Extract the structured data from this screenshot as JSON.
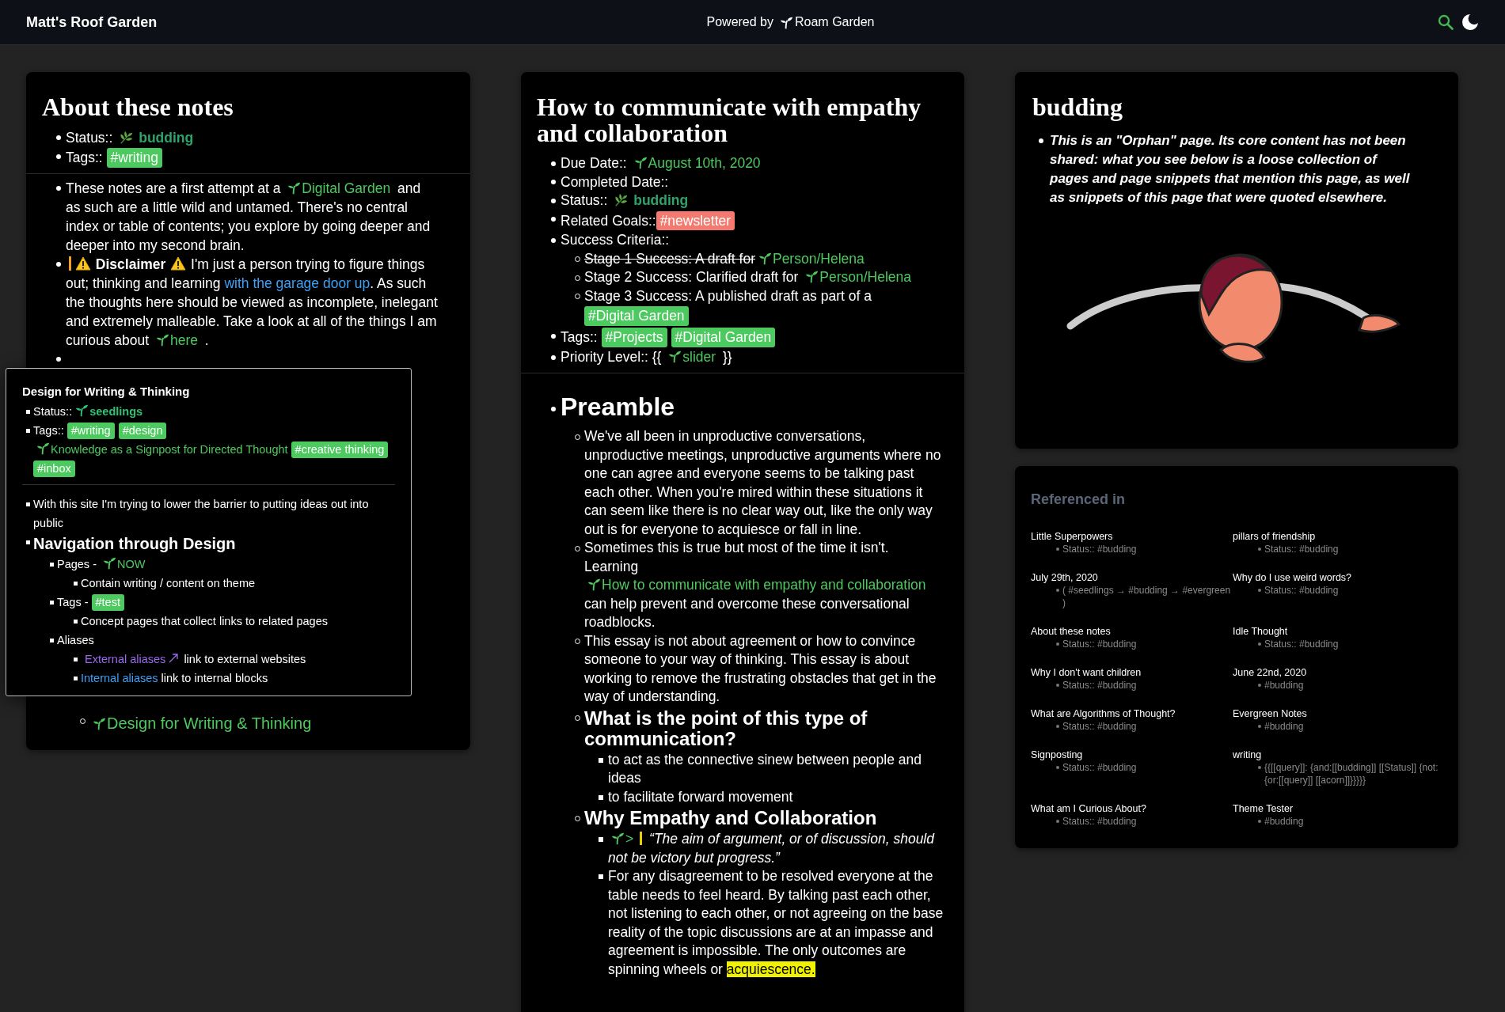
{
  "header": {
    "site_title": "Matt's Roof Garden",
    "powered_by": "Powered by",
    "product": "Roam Garden"
  },
  "left_note": {
    "title": "About these notes",
    "meta": [
      {
        "kind": "text",
        "segments": [
          {
            "kind": "text",
            "text": "Status:: "
          },
          {
            "kind": "status",
            "text": "budding"
          }
        ]
      },
      {
        "kind": "text",
        "segments": [
          {
            "kind": "text",
            "text": "Tags:: "
          },
          {
            "kind": "tag",
            "text": "#writing",
            "color": "#4cc95f"
          }
        ]
      }
    ],
    "body": [
      {
        "kind": "text",
        "segments": [
          {
            "kind": "text",
            "text": "These notes are a first attempt at a "
          },
          {
            "kind": "page",
            "text": "Digital Garden"
          },
          {
            "kind": "text",
            "text": " and as such are a little wild and untamed. There's no central index or table of contents; you explore by going deeper and deeper into my second brain."
          }
        ]
      },
      {
        "kind": "text",
        "segments": [
          {
            "kind": "bar",
            "color": "#f0a020"
          },
          {
            "kind": "warning"
          },
          {
            "kind": "bold",
            "text": " Disclaimer "
          },
          {
            "kind": "warning"
          },
          {
            "kind": "text",
            "text": " I'm just a person trying to figure things out; thinking and learning "
          },
          {
            "kind": "url",
            "text": "with the garage door up"
          },
          {
            "kind": "text",
            "text": ". As such the thoughts here should be viewed as incomplete, inelegant and extremely malleable.  Take a look at all of the things I am curious about "
          },
          {
            "kind": "page",
            "text": "here"
          },
          {
            "kind": "text",
            "text": " ."
          }
        ]
      },
      {
        "kind": "text"
      }
    ],
    "footer": [
      {
        "kind": "text",
        "segments": [
          {
            "kind": "page",
            "text": "Design for Writing & Thinking"
          }
        ]
      }
    ]
  },
  "popup": {
    "title": "Design for Writing & Thinking",
    "meta": [
      {
        "kind": "text",
        "segments": [
          {
            "kind": "text",
            "text": "Status:: "
          },
          {
            "kind": "page-bold",
            "text": "seedlings"
          }
        ]
      },
      {
        "kind": "text",
        "segments": [
          {
            "kind": "text",
            "text": "Tags:: "
          },
          {
            "kind": "tag",
            "text": "#writing",
            "color": "#4cc95f"
          },
          {
            "kind": "tag",
            "text": "#design",
            "color": "#4cc95f"
          },
          {
            "kind": "page",
            "text": "Knowledge as a Signpost for Directed Thought"
          },
          {
            "kind": "tag",
            "text": "#creative thinking",
            "color": "#4cc95f"
          },
          {
            "kind": "tag",
            "text": "#inbox",
            "color": "#4cc95f"
          }
        ]
      }
    ],
    "body": [
      {
        "kind": "text",
        "segments": [
          {
            "kind": "text",
            "text": "With this site I'm trying to lower the barrier to putting ideas out into public"
          }
        ]
      },
      {
        "kind": "h3",
        "segments": [
          {
            "kind": "text",
            "text": "Navigation through Design"
          }
        ],
        "children": [
          {
            "kind": "text",
            "segments": [
              {
                "kind": "text",
                "text": "Pages - "
              },
              {
                "kind": "page",
                "text": "NOW"
              }
            ],
            "children": [
              {
                "kind": "text",
                "segments": [
                  {
                    "kind": "text",
                    "text": "Contain writing / content on theme"
                  }
                ]
              }
            ]
          },
          {
            "kind": "text",
            "segments": [
              {
                "kind": "text",
                "text": "Tags - "
              },
              {
                "kind": "tag",
                "text": "#test",
                "color": "#4cc95f"
              }
            ],
            "children": [
              {
                "kind": "text",
                "segments": [
                  {
                    "kind": "text",
                    "text": "Concept pages that collect links to related pages"
                  }
                ]
              }
            ]
          },
          {
            "kind": "text",
            "segments": [
              {
                "kind": "text",
                "text": "Aliases"
              }
            ],
            "children": [
              {
                "kind": "text",
                "segments": [
                  {
                    "kind": "external",
                    "text": "External aliases"
                  },
                  {
                    "kind": "text",
                    "text": " link to external websites"
                  }
                ]
              },
              {
                "kind": "text",
                "segments": [
                  {
                    "kind": "url",
                    "text": "Internal aliases"
                  },
                  {
                    "kind": "text",
                    "text": " link to internal blocks"
                  }
                ]
              }
            ]
          }
        ]
      }
    ]
  },
  "middle_note": {
    "title": "How to communicate with empathy and collaboration",
    "meta": [
      {
        "kind": "text",
        "segments": [
          {
            "kind": "text",
            "text": "Due Date:: "
          },
          {
            "kind": "page",
            "text": "August 10th, 2020"
          }
        ]
      },
      {
        "kind": "text",
        "segments": [
          {
            "kind": "text",
            "text": "Completed Date::"
          }
        ]
      },
      {
        "kind": "text",
        "segments": [
          {
            "kind": "text",
            "text": "Status:: "
          },
          {
            "kind": "status",
            "text": "budding"
          }
        ]
      },
      {
        "kind": "text",
        "segments": [
          {
            "kind": "text",
            "text": "Related Goals::"
          },
          {
            "kind": "tag",
            "text": "#newsletter",
            "color": "#f47a70"
          }
        ]
      },
      {
        "kind": "text",
        "segments": [
          {
            "kind": "text",
            "text": "Success Criteria::"
          }
        ],
        "children": [
          {
            "kind": "text",
            "segments": [
              {
                "kind": "strike",
                "text": "Stage 1 Success: A draft for"
              },
              {
                "kind": "page",
                "text": "Person/Helena"
              }
            ]
          },
          {
            "kind": "text",
            "segments": [
              {
                "kind": "text",
                "text": "Stage 2 Success: Clarified draft for "
              },
              {
                "kind": "page",
                "text": "Person/Helena"
              }
            ]
          },
          {
            "kind": "text",
            "segments": [
              {
                "kind": "text",
                "text": "Stage 3 Success: A published draft as part of a "
              },
              {
                "kind": "tag",
                "text": "#Digital Garden",
                "color": "#4cc95f"
              }
            ]
          }
        ]
      },
      {
        "kind": "text",
        "segments": [
          {
            "kind": "text",
            "text": "Tags:: "
          },
          {
            "kind": "tag",
            "text": "#Projects",
            "color": "#4cc95f"
          },
          {
            "kind": "tag",
            "text": "#Digital Garden",
            "color": "#4cc95f"
          }
        ]
      },
      {
        "kind": "text",
        "segments": [
          {
            "kind": "text",
            "text": "Priority Level:: {{ "
          },
          {
            "kind": "page",
            "text": "slider"
          },
          {
            "kind": "text",
            "text": " }}"
          }
        ]
      }
    ],
    "body": [
      {
        "kind": "h2",
        "segments": [
          {
            "kind": "text",
            "text": "Preamble"
          }
        ],
        "children": [
          {
            "kind": "text",
            "segments": [
              {
                "kind": "text",
                "text": "We've all been in unproductive conversations, unproductive meetings, unproductive arguments where no one can agree and everyone seems to be talking past each other. When you're mired within these situations it can seem like there is no clear way out, like the only way out is for everyone to acquiesce or fall in line."
              }
            ]
          },
          {
            "kind": "text",
            "segments": [
              {
                "kind": "text",
                "text": "Sometimes this is true but most of the time it isn't. Learning "
              },
              {
                "kind": "page",
                "text": "How to communicate with empathy and collaboration"
              },
              {
                "kind": "text",
                "text": " can help prevent and overcome these conversational roadblocks."
              }
            ]
          },
          {
            "kind": "text",
            "segments": [
              {
                "kind": "text",
                "text": "This essay is not about agreement or how to convince someone to your way of thinking. This essay is about working to remove the frustrating obstacles that get in the way of understanding."
              }
            ]
          },
          {
            "kind": "h3",
            "segments": [
              {
                "kind": "text",
                "text": "What is the point of this type of communication?"
              }
            ],
            "children": [
              {
                "kind": "text",
                "segments": [
                  {
                    "kind": "text",
                    "text": "to act as the connective sinew between people and ideas"
                  }
                ]
              },
              {
                "kind": "text",
                "segments": [
                  {
                    "kind": "text",
                    "text": "to facilitate forward movement"
                  }
                ]
              }
            ]
          },
          {
            "kind": "h3",
            "segments": [
              {
                "kind": "text",
                "text": "Why Empathy and Collaboration"
              }
            ],
            "children": [
              {
                "kind": "text",
                "segments": [
                  {
                    "kind": "page",
                    "text": ">"
                  },
                  {
                    "kind": "bar",
                    "color": "#e8d000"
                  },
                  {
                    "kind": "italic",
                    "text": " “The aim of argument, or of discussion, should not be victory but progress.”"
                  }
                ]
              },
              {
                "kind": "text",
                "segments": [
                  {
                    "kind": "text",
                    "text": "For any disagreement to be resolved everyone at the table needs to feel heard. By talking past each other, not listening to each other, or not agreeing on the base reality of the topic discussions are at an impasse and agreement is impossible. The only outcomes are spinning wheels or "
                  },
                  {
                    "kind": "highlight",
                    "text": "acquiescence."
                  }
                ]
              }
            ]
          }
        ]
      }
    ]
  },
  "status_note": {
    "title": "budding",
    "text": "This is an \"Orphan\" page. Its core content has not been shared: what you see below is a loose collection of pages and page snippets that mention this page, as well as snippets of this page that were quoted elsewhere."
  },
  "referenced_in": {
    "heading": "Referenced in",
    "entries": [
      {
        "title": "Little Superpowers",
        "lines": [
          "Status:: #budding"
        ]
      },
      {
        "title": "pillars of friendship",
        "lines": [
          "Status:: #budding"
        ]
      },
      {
        "title": "July 29th, 2020",
        "lines": [
          "( #seedlings → #budding → #evergreen )"
        ]
      },
      {
        "title": "Why do I use weird words?",
        "lines": [
          "Status:: #budding"
        ]
      },
      {
        "title": "About these notes",
        "lines": [
          "Status:: #budding"
        ]
      },
      {
        "title": "Idle Thought",
        "lines": [
          "Status:: #budding"
        ]
      },
      {
        "title": "Why I don't want children",
        "lines": [
          "Status:: #budding"
        ]
      },
      {
        "title": "June 22nd, 2020",
        "lines": [
          "#budding"
        ]
      },
      {
        "title": "What are Algorithms of Thought?",
        "lines": [
          "Status::  #budding"
        ]
      },
      {
        "title": "Evergreen Notes",
        "lines": [
          "#budding"
        ]
      },
      {
        "title": "Signposting",
        "lines": [
          "Status:: #budding"
        ]
      },
      {
        "title": "writing",
        "lines": [
          "{{[[query]]: {and:[[budding]] [[Status]] {not:{or:[[query]] [[acorn]]}}}}}"
        ]
      },
      {
        "title": "What am I Curious About?",
        "lines": [
          "Status:: #budding"
        ]
      },
      {
        "title": "Theme Tester",
        "lines": [
          "#budding"
        ]
      }
    ]
  }
}
